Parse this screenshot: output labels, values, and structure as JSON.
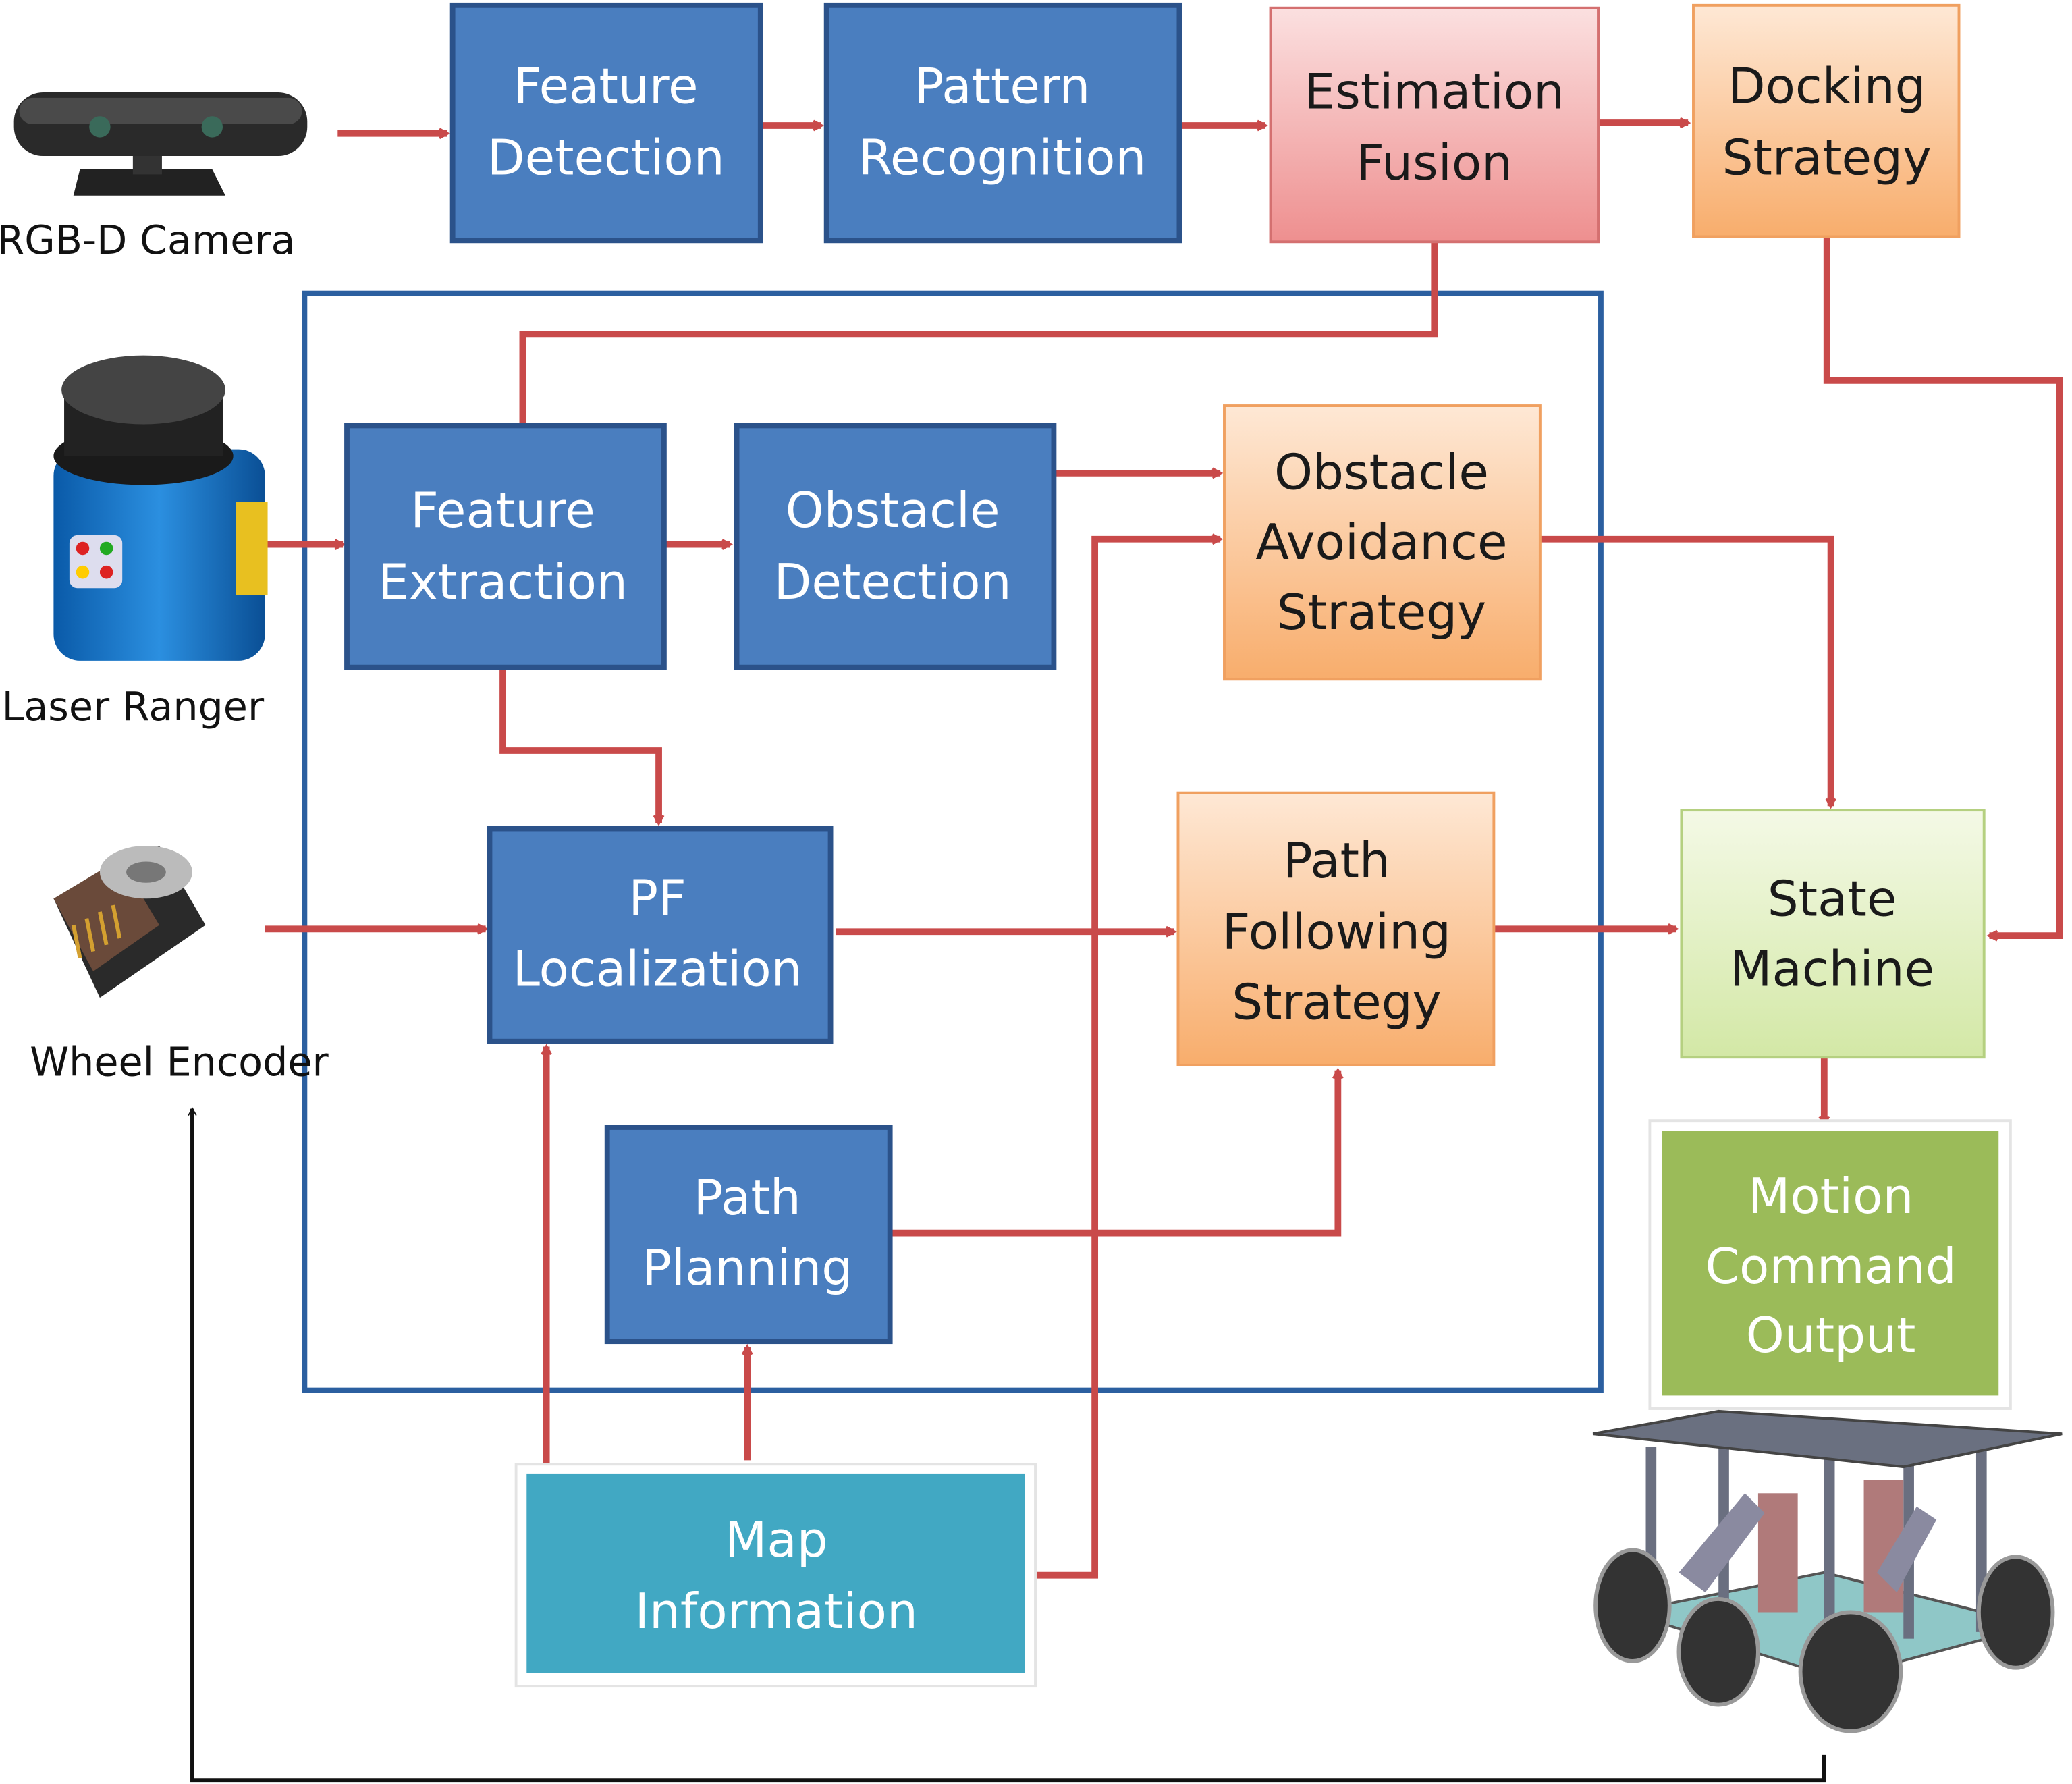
{
  "colors": {
    "blue_box": "#4a7ebf",
    "blue_border": "#2b528a",
    "fusion": "#f4b3b3",
    "orange": "#fbc796",
    "state_machine": "#e4f0c4",
    "motion_output": "#9bbb59",
    "map_info": "#41a8c3",
    "arrow": "#c94a4a",
    "feedback": "#111111"
  },
  "sensors": {
    "camera": "RGB-D Camera",
    "laser": "Laser Ranger",
    "encoder": "Wheel Encoder"
  },
  "boxes": {
    "feature_detection": [
      "Feature",
      "Detection"
    ],
    "pattern_recognition": [
      "Pattern",
      "Recognition"
    ],
    "estimation_fusion": [
      "Estimation",
      "Fusion"
    ],
    "docking_strategy": [
      "Docking",
      "Strategy"
    ],
    "feature_extraction": [
      "Feature",
      "Extraction"
    ],
    "obstacle_detection": [
      "Obstacle",
      "Detection"
    ],
    "obstacle_avoidance": [
      "Obstacle",
      "Avoidance",
      "Strategy"
    ],
    "pf_localization": [
      "PF",
      "Localization"
    ],
    "path_following": [
      "Path",
      "Following",
      "Strategy"
    ],
    "state_machine": [
      "State",
      "Machine"
    ],
    "path_planning": [
      "Path",
      "Planning"
    ],
    "map_information": [
      "Map",
      "Information"
    ],
    "motion_command_output": [
      "Motion",
      "Command",
      "Output"
    ]
  }
}
